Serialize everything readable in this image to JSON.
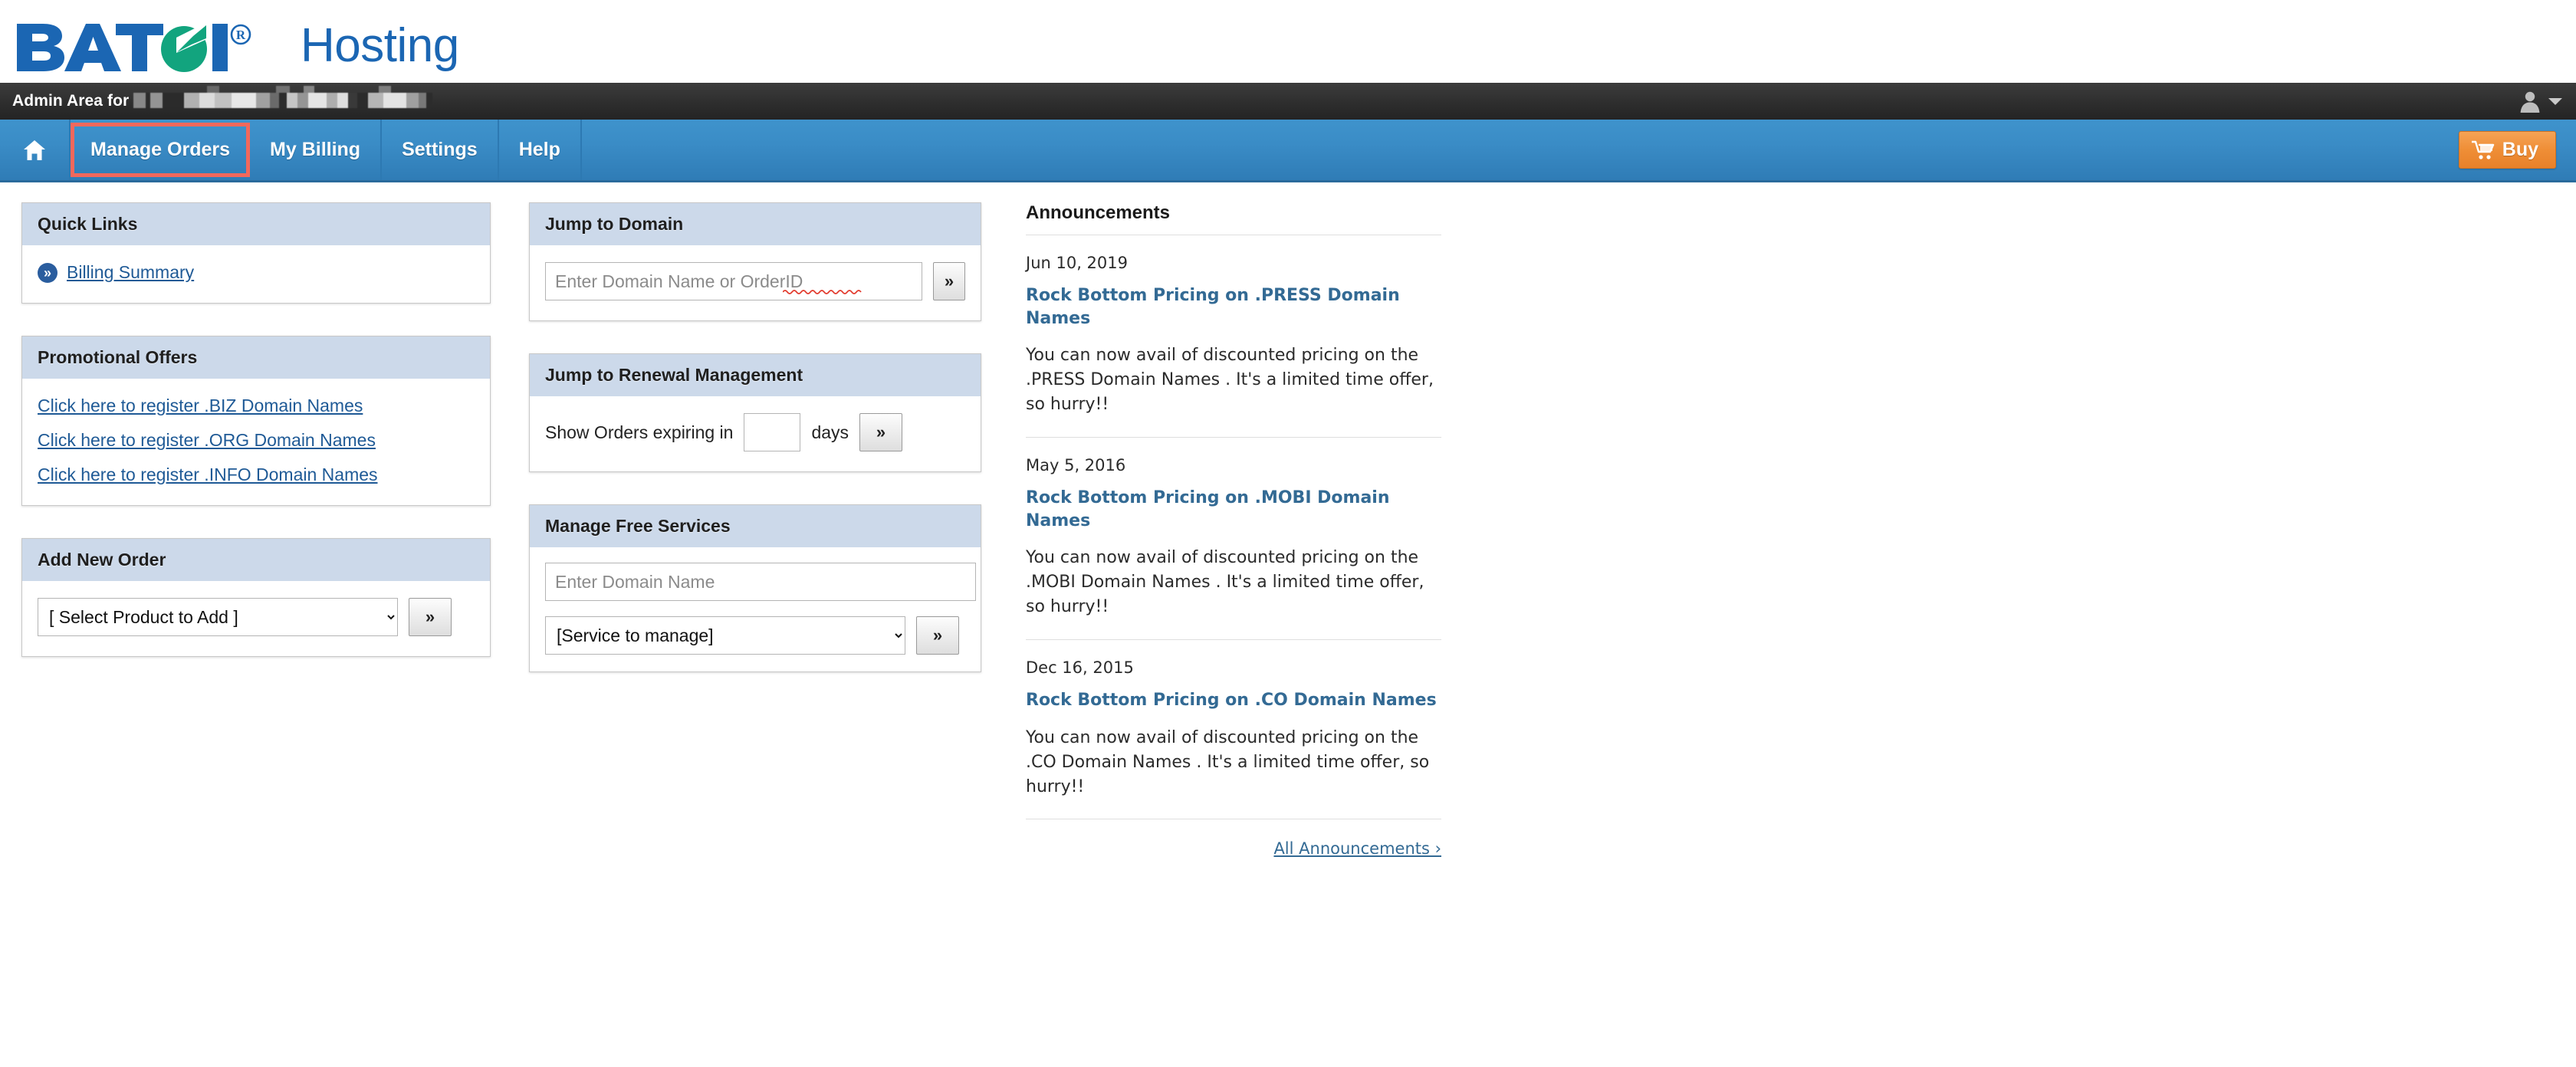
{
  "brand": {
    "logo_text": "BATOI",
    "registered_mark": "®",
    "product": "Hosting",
    "logo_blue": "#1b66b3",
    "logo_green": "#12a47e"
  },
  "admin_bar": {
    "label": "Admin Area for",
    "account_name_redacted": "",
    "user_icon": "user-avatar-icon",
    "caret_icon": "chevron-down-icon"
  },
  "nav": {
    "home_icon": "home-icon",
    "items": [
      {
        "label": "Manage Orders",
        "active": true
      },
      {
        "label": "My Billing",
        "active": false
      },
      {
        "label": "Settings",
        "active": false
      },
      {
        "label": "Help",
        "active": false
      }
    ],
    "active_highlight_color": "#f2685c",
    "buy": {
      "label": "Buy",
      "icon": "shopping-cart-icon",
      "color": "#ef8e36"
    }
  },
  "quick_links": {
    "title": "Quick Links",
    "bullet_icon": "double-chevron-right-icon",
    "items": [
      {
        "label": "Billing Summary"
      }
    ]
  },
  "promotional_offers": {
    "title": "Promotional Offers",
    "items": [
      {
        "label": "Click here to register .BIZ Domain Names"
      },
      {
        "label": "Click here to register .ORG Domain Names"
      },
      {
        "label": "Click here to register .INFO Domain Names"
      }
    ]
  },
  "add_new_order": {
    "title": "Add New Order",
    "select_value": "[ Select Product to Add ]",
    "go_label": "»"
  },
  "jump_to_domain": {
    "title": "Jump to Domain",
    "input_placeholder": "Enter Domain Name or OrderID",
    "input_value": "",
    "go_label": "»"
  },
  "jump_to_renewal": {
    "title": "Jump to Renewal Management",
    "label_before": "Show Orders expiring in",
    "days_value": "",
    "label_after": "days",
    "go_label": "»"
  },
  "manage_free_services": {
    "title": "Manage Free Services",
    "domain_placeholder": "Enter Domain Name",
    "domain_value": "",
    "service_value": "[Service to manage]",
    "go_label": "»"
  },
  "announcements": {
    "title": "Announcements",
    "items": [
      {
        "date": "Jun 10, 2019",
        "headline": "Rock Bottom Pricing on .PRESS Domain Names",
        "body": "You can now avail of discounted pricing on the .PRESS Domain Names . It's a limited time offer, so hurry!!"
      },
      {
        "date": "May 5, 2016",
        "headline": "Rock Bottom Pricing on .MOBI Domain Names",
        "body": "You can now avail of discounted pricing on the .MOBI Domain Names . It's a limited time offer, so hurry!!"
      },
      {
        "date": "Dec 16, 2015",
        "headline": "Rock Bottom Pricing on .CO Domain Names",
        "body": "You can now avail of discounted pricing on the .CO Domain Names . It's a limited time offer, so hurry!!"
      }
    ],
    "all_link": "All Announcements ›"
  }
}
